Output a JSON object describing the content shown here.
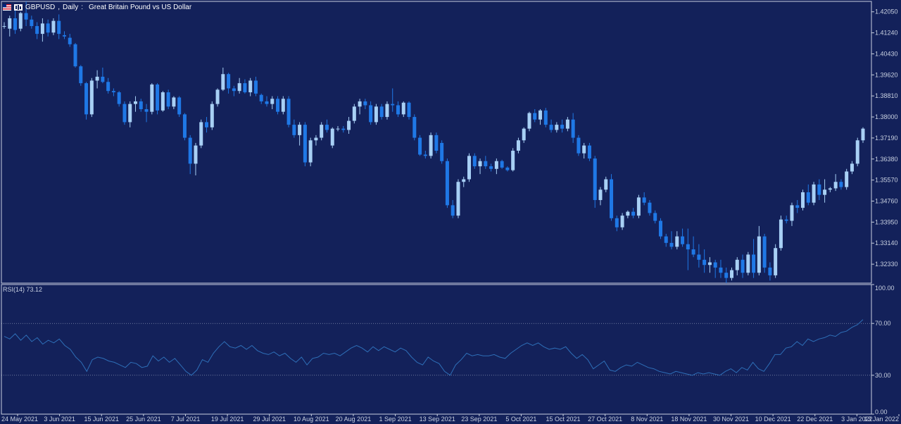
{
  "header": {
    "symbol": "GBPUSD",
    "timeframe": "Daily",
    "description": "Great Britain Pound vs US Dollar"
  },
  "rsi_panel": {
    "label": "RSI(14) 73.12",
    "levels": [
      70,
      30
    ],
    "axis_labels": [
      "100.00",
      "70.00",
      "30.00",
      "0.00"
    ]
  },
  "colors": {
    "background": "#13215a",
    "bull": "#a8d0f5",
    "bear": "#1f78e6",
    "rsi_line": "#2e6fb8",
    "axis": "#c8d0e0"
  },
  "chart_data": [
    {
      "type": "candlestick",
      "title": "GBPUSD, Daily: Great Britain Pound vs US Dollar",
      "ylim": [
        1.316,
        1.4245
      ],
      "y_ticks": [
        "1.42050",
        "1.41240",
        "1.40430",
        "1.39620",
        "1.38810",
        "1.38000",
        "1.37190",
        "1.36380",
        "1.35570",
        "1.34760",
        "1.33950",
        "1.33140",
        "1.32330"
      ],
      "x_ticks": [
        "24 May 2021",
        "3 Jun 2021",
        "15 Jun 2021",
        "25 Jun 2021",
        "7 Jul 2021",
        "19 Jul 2021",
        "29 Jul 2021",
        "10 Aug 2021",
        "20 Aug 2021",
        "1 Sep 2021",
        "13 Sep 2021",
        "23 Sep 2021",
        "5 Oct 2021",
        "15 Oct 2021",
        "27 Oct 2021",
        "8 Nov 2021",
        "18 Nov 2021",
        "30 Nov 2021",
        "10 Dec 2021",
        "22 Dec 2021",
        "3 Jan 2022",
        "13 Jan 2022"
      ],
      "candles": [
        [
          1.415,
          1.4165,
          1.414,
          1.415
        ],
        [
          1.414,
          1.419,
          1.411,
          1.418
        ],
        [
          1.418,
          1.422,
          1.412,
          1.4135
        ],
        [
          1.414,
          1.4205,
          1.413,
          1.42
        ],
        [
          1.42,
          1.4245,
          1.415,
          1.4175
        ],
        [
          1.4175,
          1.419,
          1.414,
          1.415
        ],
        [
          1.415,
          1.4165,
          1.41,
          1.412
        ],
        [
          1.412,
          1.418,
          1.409,
          1.416
        ],
        [
          1.416,
          1.4175,
          1.411,
          1.4125
        ],
        [
          1.4125,
          1.418,
          1.4115,
          1.417
        ],
        [
          1.417,
          1.4195,
          1.41,
          1.412
        ],
        [
          1.4115,
          1.413,
          1.41,
          1.411
        ],
        [
          1.4105,
          1.412,
          1.407,
          1.408
        ],
        [
          1.408,
          1.4085,
          1.399,
          1.3995
        ],
        [
          1.3995,
          1.4,
          1.392,
          1.393
        ],
        [
          1.393,
          1.3935,
          1.379,
          1.381
        ],
        [
          1.381,
          1.395,
          1.38,
          1.394
        ],
        [
          1.394,
          1.398,
          1.391,
          1.3955
        ],
        [
          1.3955,
          1.399,
          1.393,
          1.3935
        ],
        [
          1.3935,
          1.395,
          1.389,
          1.39
        ],
        [
          1.39,
          1.391,
          1.388,
          1.3895
        ],
        [
          1.3895,
          1.39,
          1.384,
          1.385
        ],
        [
          1.385,
          1.386,
          1.377,
          1.378
        ],
        [
          1.378,
          1.386,
          1.376,
          1.385
        ],
        [
          1.385,
          1.388,
          1.382,
          1.386
        ],
        [
          1.386,
          1.387,
          1.382,
          1.383
        ],
        [
          1.383,
          1.385,
          1.378,
          1.382
        ],
        [
          1.382,
          1.393,
          1.381,
          1.3925
        ],
        [
          1.3925,
          1.393,
          1.381,
          1.3825
        ],
        [
          1.3825,
          1.39,
          1.382,
          1.3895
        ],
        [
          1.3895,
          1.3905,
          1.383,
          1.384
        ],
        [
          1.384,
          1.388,
          1.383,
          1.3875
        ],
        [
          1.3875,
          1.388,
          1.38,
          1.381
        ],
        [
          1.381,
          1.3815,
          1.371,
          1.372
        ],
        [
          1.372,
          1.373,
          1.358,
          1.362
        ],
        [
          1.362,
          1.37,
          1.3575,
          1.369
        ],
        [
          1.369,
          1.379,
          1.368,
          1.378
        ],
        [
          1.378,
          1.38,
          1.374,
          1.376
        ],
        [
          1.376,
          1.386,
          1.375,
          1.385
        ],
        [
          1.385,
          1.391,
          1.384,
          1.3905
        ],
        [
          1.3905,
          1.399,
          1.39,
          1.3965
        ],
        [
          1.3965,
          1.397,
          1.389,
          1.391
        ],
        [
          1.391,
          1.392,
          1.388,
          1.39
        ],
        [
          1.39,
          1.395,
          1.389,
          1.393
        ],
        [
          1.393,
          1.3945,
          1.389,
          1.3895
        ],
        [
          1.3895,
          1.395,
          1.388,
          1.394
        ],
        [
          1.394,
          1.3955,
          1.388,
          1.389
        ],
        [
          1.3885,
          1.389,
          1.385,
          1.386
        ],
        [
          1.386,
          1.388,
          1.384,
          1.385
        ],
        [
          1.385,
          1.388,
          1.383,
          1.387
        ],
        [
          1.387,
          1.388,
          1.381,
          1.382
        ],
        [
          1.382,
          1.388,
          1.381,
          1.387
        ],
        [
          1.387,
          1.388,
          1.376,
          1.377
        ],
        [
          1.377,
          1.379,
          1.372,
          1.373
        ],
        [
          1.373,
          1.378,
          1.369,
          1.377
        ],
        [
          1.377,
          1.378,
          1.361,
          1.3625
        ],
        [
          1.3625,
          1.372,
          1.361,
          1.371
        ],
        [
          1.371,
          1.373,
          1.369,
          1.372
        ],
        [
          1.372,
          1.378,
          1.371,
          1.377
        ],
        [
          1.377,
          1.379,
          1.374,
          1.375
        ],
        [
          1.369,
          1.376,
          1.368,
          1.3755
        ],
        [
          1.3755,
          1.3765,
          1.3745,
          1.3755
        ],
        [
          1.3755,
          1.3765,
          1.374,
          1.375
        ],
        [
          1.375,
          1.38,
          1.3735,
          1.3785
        ],
        [
          1.3785,
          1.385,
          1.3775,
          1.384
        ],
        [
          1.384,
          1.387,
          1.381,
          1.386
        ],
        [
          1.386,
          1.387,
          1.383,
          1.3845
        ],
        [
          1.3845,
          1.386,
          1.377,
          1.378
        ],
        [
          1.378,
          1.385,
          1.377,
          1.384
        ],
        [
          1.384,
          1.385,
          1.379,
          1.38
        ],
        [
          1.38,
          1.386,
          1.379,
          1.385
        ],
        [
          1.385,
          1.391,
          1.382,
          1.3845
        ],
        [
          1.3845,
          1.386,
          1.38,
          1.381
        ],
        [
          1.381,
          1.386,
          1.38,
          1.3855
        ],
        [
          1.3855,
          1.386,
          1.379,
          1.38
        ],
        [
          1.38,
          1.381,
          1.371,
          1.372
        ],
        [
          1.372,
          1.373,
          1.365,
          1.3655
        ],
        [
          1.3655,
          1.367,
          1.364,
          1.365
        ],
        [
          1.365,
          1.374,
          1.364,
          1.373
        ],
        [
          1.373,
          1.374,
          1.366,
          1.367
        ],
        [
          1.37,
          1.371,
          1.362,
          1.363
        ],
        [
          1.363,
          1.364,
          1.345,
          1.346
        ],
        [
          1.346,
          1.348,
          1.341,
          1.342
        ],
        [
          1.342,
          1.356,
          1.341,
          1.355
        ],
        [
          1.355,
          1.357,
          1.353,
          1.356
        ],
        [
          1.356,
          1.366,
          1.355,
          1.365
        ],
        [
          1.365,
          1.366,
          1.36,
          1.361
        ],
        [
          1.361,
          1.364,
          1.358,
          1.363
        ],
        [
          1.363,
          1.365,
          1.36,
          1.361
        ],
        [
          1.361,
          1.362,
          1.359,
          1.36
        ],
        [
          1.36,
          1.364,
          1.358,
          1.363
        ],
        [
          1.363,
          1.3635,
          1.36,
          1.3605
        ],
        [
          1.3605,
          1.361,
          1.359,
          1.3595
        ],
        [
          1.3595,
          1.368,
          1.359,
          1.367
        ],
        [
          1.367,
          1.372,
          1.366,
          1.371
        ],
        [
          1.371,
          1.376,
          1.37,
          1.3755
        ],
        [
          1.3755,
          1.382,
          1.3745,
          1.3815
        ],
        [
          1.3815,
          1.383,
          1.378,
          1.379
        ],
        [
          1.379,
          1.383,
          1.377,
          1.3825
        ],
        [
          1.3825,
          1.3835,
          1.376,
          1.377
        ],
        [
          1.377,
          1.379,
          1.374,
          1.375
        ],
        [
          1.375,
          1.378,
          1.374,
          1.377
        ],
        [
          1.377,
          1.379,
          1.374,
          1.3755
        ],
        [
          1.3755,
          1.38,
          1.3745,
          1.379
        ],
        [
          1.379,
          1.3815,
          1.37,
          1.372
        ],
        [
          1.372,
          1.373,
          1.365,
          1.366
        ],
        [
          1.366,
          1.37,
          1.364,
          1.369
        ],
        [
          1.369,
          1.37,
          1.363,
          1.364
        ],
        [
          1.364,
          1.365,
          1.345,
          1.348
        ],
        [
          1.348,
          1.353,
          1.346,
          1.352
        ],
        [
          1.352,
          1.357,
          1.351,
          1.356
        ],
        [
          1.356,
          1.358,
          1.34,
          1.341
        ],
        [
          1.341,
          1.342,
          1.336,
          1.3375
        ],
        [
          1.3375,
          1.343,
          1.3365,
          1.342
        ],
        [
          1.342,
          1.344,
          1.341,
          1.3435
        ],
        [
          1.3435,
          1.345,
          1.341,
          1.342
        ],
        [
          1.342,
          1.35,
          1.341,
          1.349
        ],
        [
          1.349,
          1.351,
          1.346,
          1.347
        ],
        [
          1.347,
          1.348,
          1.342,
          1.343
        ],
        [
          1.343,
          1.344,
          1.339,
          1.34
        ],
        [
          1.34,
          1.341,
          1.333,
          1.334
        ],
        [
          1.334,
          1.335,
          1.33,
          1.3315
        ],
        [
          1.3315,
          1.336,
          1.329,
          1.33
        ],
        [
          1.33,
          1.336,
          1.329,
          1.334
        ],
        [
          1.334,
          1.337,
          1.33,
          1.331
        ],
        [
          1.331,
          1.337,
          1.321,
          1.329
        ],
        [
          1.329,
          1.334,
          1.326,
          1.327
        ],
        [
          1.327,
          1.331,
          1.322,
          1.325
        ],
        [
          1.325,
          1.329,
          1.32,
          1.323
        ],
        [
          1.323,
          1.326,
          1.32,
          1.324
        ],
        [
          1.324,
          1.325,
          1.318,
          1.322
        ],
        [
          1.322,
          1.325,
          1.318,
          1.32
        ],
        [
          1.32,
          1.322,
          1.316,
          1.318
        ],
        [
          1.318,
          1.322,
          1.317,
          1.321
        ],
        [
          1.321,
          1.326,
          1.319,
          1.325
        ],
        [
          1.325,
          1.327,
          1.318,
          1.32
        ],
        [
          1.32,
          1.328,
          1.319,
          1.327
        ],
        [
          1.327,
          1.333,
          1.318,
          1.32
        ],
        [
          1.32,
          1.338,
          1.319,
          1.334
        ],
        [
          1.334,
          1.335,
          1.32,
          1.322
        ],
        [
          1.322,
          1.324,
          1.317,
          1.319
        ],
        [
          1.319,
          1.331,
          1.318,
          1.3295
        ],
        [
          1.3295,
          1.342,
          1.3285,
          1.3405
        ],
        [
          1.3405,
          1.342,
          1.339,
          1.34
        ],
        [
          1.34,
          1.347,
          1.338,
          1.346
        ],
        [
          1.346,
          1.348,
          1.343,
          1.345
        ],
        [
          1.345,
          1.352,
          1.344,
          1.351
        ],
        [
          1.351,
          1.354,
          1.346,
          1.347
        ],
        [
          1.347,
          1.355,
          1.346,
          1.354
        ],
        [
          1.354,
          1.356,
          1.348,
          1.35
        ],
        [
          1.35,
          1.356,
          1.347,
          1.352
        ],
        [
          1.352,
          1.353,
          1.351,
          1.3525
        ],
        [
          1.3525,
          1.358,
          1.3515,
          1.355
        ],
        [
          1.355,
          1.356,
          1.352,
          1.353
        ],
        [
          1.353,
          1.36,
          1.352,
          1.359
        ],
        [
          1.359,
          1.363,
          1.358,
          1.362
        ],
        [
          1.362,
          1.372,
          1.361,
          1.371
        ],
        [
          1.371,
          1.376,
          1.37,
          1.3755
        ]
      ]
    },
    {
      "type": "line",
      "title": "RSI(14) 73.12",
      "ylim": [
        0,
        100
      ],
      "y_ticks": [
        "100.00",
        "70.00",
        "30.00",
        "0.00"
      ],
      "levels": [
        70,
        30
      ],
      "values": [
        60,
        58,
        62,
        57,
        61,
        56,
        59,
        54,
        57,
        55,
        58,
        53,
        50,
        44,
        40,
        33,
        42,
        44,
        43,
        41,
        40,
        38,
        36,
        40,
        39,
        36,
        37,
        45,
        41,
        44,
        40,
        43,
        38,
        33,
        30,
        34,
        42,
        40,
        47,
        52,
        56,
        52,
        51,
        53,
        50,
        53,
        49,
        47,
        46,
        48,
        45,
        47,
        43,
        40,
        44,
        38,
        43,
        44,
        47,
        46,
        47,
        45,
        48,
        51,
        53,
        51,
        48,
        52,
        49,
        52,
        50,
        48,
        51,
        49,
        44,
        40,
        38,
        44,
        41,
        39,
        33,
        30,
        38,
        42,
        47,
        45,
        46,
        45,
        45,
        46,
        44,
        43,
        47,
        50,
        53,
        55,
        53,
        55,
        52,
        50,
        51,
        50,
        52,
        47,
        43,
        46,
        42,
        35,
        38,
        41,
        34,
        33,
        36,
        38,
        37,
        40,
        38,
        36,
        35,
        33,
        32,
        31,
        33,
        32,
        31,
        30,
        32,
        31,
        32,
        31,
        30,
        33,
        35,
        32,
        36,
        34,
        40,
        35,
        33,
        39,
        46,
        46,
        51,
        52,
        56,
        53,
        58,
        56,
        58,
        59,
        61,
        60,
        63,
        64,
        67,
        69,
        73
      ]
    }
  ]
}
